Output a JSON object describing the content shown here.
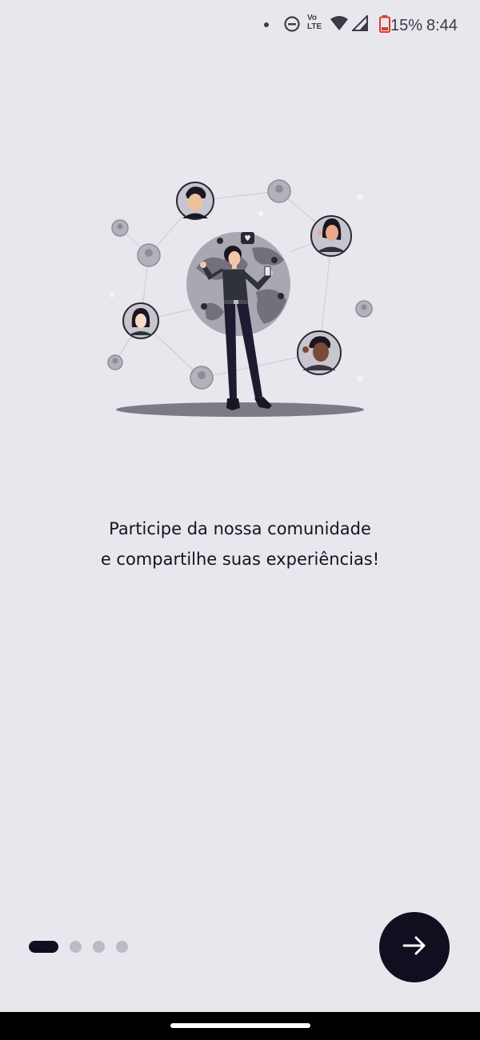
{
  "status_bar": {
    "battery": "15%",
    "time": "8:44",
    "volte_top": "Vo",
    "volte_bottom": "LTE",
    "icons": [
      "notification-dot-icon",
      "do-not-disturb-icon",
      "volte-icon",
      "wifi-icon",
      "cell-signal-icon",
      "battery-low-icon"
    ]
  },
  "onboarding": {
    "line1": "Participe da nossa comunidade",
    "line2": "e compartilhe suas experiências!",
    "page_count": 4,
    "current_page": 1
  },
  "next_button": {
    "icon": "arrow-right-icon"
  },
  "colors": {
    "background": "#e9e7ee",
    "primary_dark": "#120d1f",
    "inactive_dot": "#bdbac8"
  }
}
